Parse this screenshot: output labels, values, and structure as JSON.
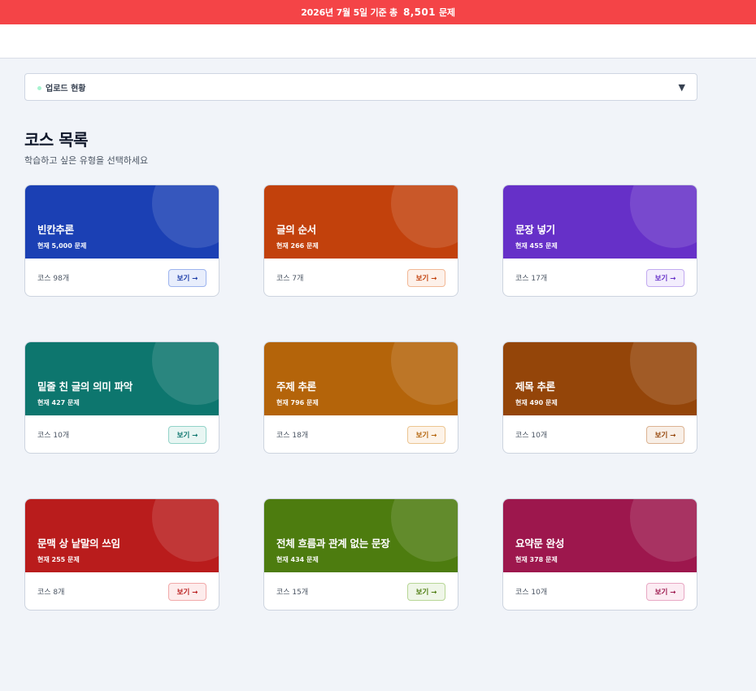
{
  "banner": {
    "prefix": "2026년 7월 5일 기준 총",
    "count": "8,501",
    "suffix": "문제"
  },
  "upload": {
    "label": "업로드 현황",
    "arrow": "▼"
  },
  "page": {
    "title": "코스 목록",
    "subtitle": "학습하고 싶은 유형을 선택하세요"
  },
  "cards": [
    {
      "name": "빈칸추론",
      "count": "현재 5,000 문제",
      "courses": "코스 98개",
      "button": "보기 →",
      "color": "#1b40b4",
      "btn_bg": "#e8eefc",
      "btn_fg": "#1d3ea8",
      "btn_border": "#9db4ee"
    },
    {
      "name": "글의 순서",
      "count": "현재 266 문제",
      "courses": "코스 7개",
      "button": "보기 →",
      "color": "#c2410c",
      "btn_bg": "#fdf1ea",
      "btn_fg": "#c2410c",
      "btn_border": "#f2b896"
    },
    {
      "name": "문장 넣기",
      "count": "현재 455 문제",
      "courses": "코스 17개",
      "button": "보기 →",
      "color": "#6630c8",
      "btn_bg": "#f3eefd",
      "btn_fg": "#6630c8",
      "btn_border": "#c2aaf0"
    },
    {
      "name": "밑줄 친 글의 의미 파악",
      "count": "현재 427 문제",
      "courses": "코스 10개",
      "button": "보기 →",
      "color": "#0d766e",
      "btn_bg": "#e8f6f3",
      "btn_fg": "#0d766e",
      "btn_border": "#92d3c8"
    },
    {
      "name": "주제 추론",
      "count": "현재 796 문제",
      "courses": "코스 18개",
      "button": "보기 →",
      "color": "#b4640a",
      "btn_bg": "#fdf3e8",
      "btn_fg": "#b4640a",
      "btn_border": "#ecc591"
    },
    {
      "name": "제목 추론",
      "count": "현재 490 문제",
      "courses": "코스 10개",
      "button": "보기 →",
      "color": "#944509",
      "btn_bg": "#f8efe7",
      "btn_fg": "#944509",
      "btn_border": "#dcb392"
    },
    {
      "name": "문맥 상 낱말의 쓰임",
      "count": "현재 255 문제",
      "courses": "코스 8개",
      "button": "보기 →",
      "color": "#b91c1c",
      "btn_bg": "#fdecec",
      "btn_fg": "#b91c1c",
      "btn_border": "#f1a9a9"
    },
    {
      "name": "전체 흐름과 관계 없는 문장",
      "count": "현재 434 문제",
      "courses": "코스 15개",
      "button": "보기 →",
      "color": "#4d7c0f",
      "btn_bg": "#eff6e8",
      "btn_fg": "#4d7c0f",
      "btn_border": "#b7d696"
    },
    {
      "name": "요약문 완성",
      "count": "현재 378 문제",
      "courses": "코스 10개",
      "button": "보기 →",
      "color": "#9d174d",
      "btn_bg": "#fcecf3",
      "btn_fg": "#9d174d",
      "btn_border": "#e8a8c4"
    }
  ]
}
